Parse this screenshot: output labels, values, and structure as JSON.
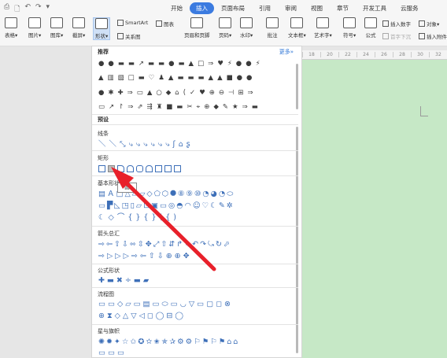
{
  "quick_access": [
    "⎙",
    "🗋",
    "↶",
    "↷",
    "▾"
  ],
  "menu": {
    "tabs": [
      "开始",
      "插入",
      "页面布局",
      "引用",
      "审阅",
      "视图",
      "章节",
      "开发工具",
      "云服务"
    ],
    "active_tab": "插入"
  },
  "ribbon": {
    "table": "表格▾",
    "picture": "图片▾",
    "gallery": "图库▾",
    "screenshot": "截屏▾",
    "shapes": "形状▾",
    "smartart": "SmartArt",
    "chart": "图表",
    "relation": "关系图",
    "header_footer": "页眉和页脚",
    "page_number": "页码▾",
    "watermark": "水印▾",
    "comment": "批注",
    "textbox": "文本框▾",
    "wordart": "艺术字▾",
    "symbol": "符号▾",
    "formula": "公式",
    "insert_number": "插入数字",
    "object": "对象▾",
    "first_letter": "首字下沉",
    "insert_attachment": "插入附件"
  },
  "ruler": [
    "18",
    "20",
    "22",
    "24",
    "26",
    "28",
    "30",
    "32"
  ],
  "panel": {
    "recommended_title": "推荐",
    "more": "更多»",
    "recommended_rows": [
      "●●▬▬↗▬▬●▬▲□⇒♥⚡●●⚡",
      "▲▥▧□▬♡♟▲▬▬▬▲▲■●●",
      "●✱✚⇒▭▲○◆⌂(✓♥⊕⊖⊣⊞⇒",
      "▭↗↾⇒⇗⇶♜■▬✂⌖⊕◆✎★⇒▬"
    ],
    "preset_title": "预设",
    "sections": {
      "lines": "线条",
      "rect": "矩形",
      "basic": "基本形状",
      "arrows": "箭头总汇",
      "formula": "公式形状",
      "flowchart": "流程图",
      "stars": "星与旗帜"
    },
    "lines_row": "＼＼⤡⤷⤷⤷⤷⤷⤷ʃ⌂ʂ",
    "basic_rows": [
      "▤Ａ□△▱▱◇⬠⬡⯃⑧⑨⑩◔◕◔⬭",
      "▭▛◺◳▯▱⊡▣▭◎◓◠☺♡☾✎✲",
      "☾◇⌒{}{}({)"
    ],
    "arrow_rows": [
      "⇨⇦⇧⇩⬄⇳✥⤢⇧⇵↱↳↶↷⤿↻⬀",
      "⇨▷▷▷⇨⇦⇧⇩⊕⊕✥"
    ],
    "formula_row": "✚▬✖÷▬▰",
    "flow_rows": [
      "▭▭◇▱▭▤▭⬭▭◡▽▭▢◻⊗",
      "⊕⧗◇△▽◁◻◯⊟◯"
    ],
    "star_rows": [
      "✺✹✦☆✩✪✫✬✯✰⚙⚙⚐⚑⚐⚑⌂⌂",
      "▭▭▭"
    ]
  },
  "tooltip": "圆"
}
